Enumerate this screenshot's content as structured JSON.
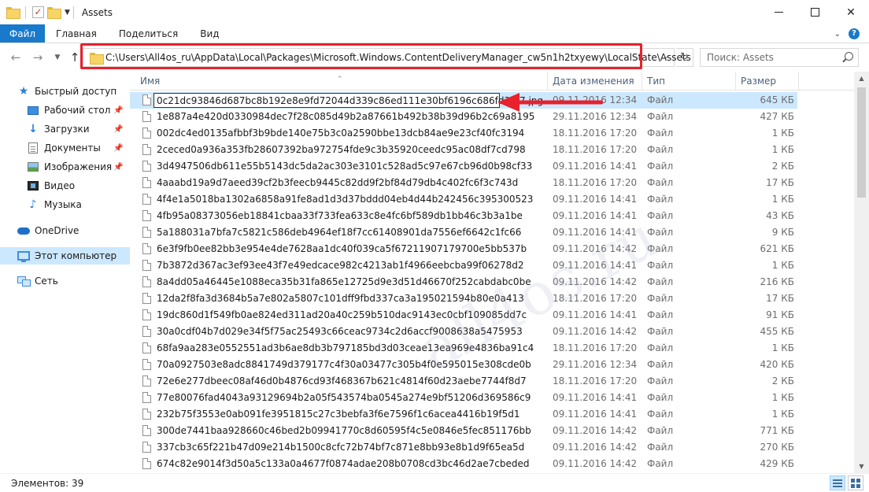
{
  "window": {
    "title": "Assets",
    "minimize_label": "—",
    "close_label": "✕"
  },
  "ribbon": {
    "tabs": [
      "Файл",
      "Главная",
      "Поделиться",
      "Вид"
    ],
    "help_label": "?"
  },
  "address": {
    "path": "C:\\Users\\All4os_ru\\AppData\\Local\\Packages\\Microsoft.Windows.ContentDeliveryManager_cw5n1h2txyewy\\LocalState\\Assets",
    "refresh_label": "↻"
  },
  "search": {
    "placeholder": "Поиск: Assets"
  },
  "nav": {
    "items": [
      {
        "label": "Быстрый доступ",
        "icon": "star-icon"
      },
      {
        "label": "Рабочий стол",
        "icon": "desktop-icon",
        "pinned": true
      },
      {
        "label": "Загрузки",
        "icon": "downloads-icon",
        "pinned": true
      },
      {
        "label": "Документы",
        "icon": "documents-icon",
        "pinned": true
      },
      {
        "label": "Изображения",
        "icon": "pictures-icon",
        "pinned": true
      },
      {
        "label": "Видео",
        "icon": "video-icon"
      },
      {
        "label": "Музыка",
        "icon": "music-icon"
      },
      {
        "label": "OneDrive",
        "icon": "onedrive-icon"
      },
      {
        "label": "Этот компьютер",
        "icon": "this-pc-icon",
        "selected": true
      },
      {
        "label": "Сеть",
        "icon": "network-icon"
      }
    ]
  },
  "columns": {
    "name": "Имя",
    "date": "Дата изменения",
    "type": "Тип",
    "size": "Размер"
  },
  "files": [
    {
      "name": "0c21dc93846d687bc8b192e8e9fd72044d339c86ed111e30bf6196c686fd39f7.jpg",
      "date": "09.11.2016 12:34",
      "type": "Файл",
      "size": "645 КБ",
      "selected": true,
      "renaming": true
    },
    {
      "name": "1e887a4e420d0330984dec7f28c085d49b2a87661b492b38b39d96b2c69a8195",
      "date": "29.11.2016 12:34",
      "type": "Файл",
      "size": "427 КБ"
    },
    {
      "name": "002dc4ed0135afbbf3b9bde140e75b3c0a2590bbe13dcb84ae9e23cf40fc3194",
      "date": "18.11.2016 17:20",
      "type": "Файл",
      "size": "1 КБ"
    },
    {
      "name": "2ceced0a936a353fb28607392ba972754fde9c3b35920ceedc95ac08df7cd798",
      "date": "18.11.2016 17:20",
      "type": "Файл",
      "size": "1 КБ"
    },
    {
      "name": "3d4947506db611e55b5143dc5da2ac303e3101c528ad5c97e67cb96d0b98cf33",
      "date": "09.11.2016 14:41",
      "type": "Файл",
      "size": "2 КБ"
    },
    {
      "name": "4aaabd19a9d7aeed39cf2b3feecb9445c82dd9f2bf84d79db4c402fc6f3c743d",
      "date": "18.11.2016 17:20",
      "type": "Файл",
      "size": "17 КБ"
    },
    {
      "name": "4f4e1a5018ba1302a6858a91fe8ad1d3d37bddd04eb4d44b242456c395300523",
      "date": "09.11.2016 14:41",
      "type": "Файл",
      "size": "1 КБ"
    },
    {
      "name": "4fb95a08373056eb18841cbaa33f733fea633c8e4fc6bf589db1bb46c3b3a1be",
      "date": "09.11.2016 14:41",
      "type": "Файл",
      "size": "43 КБ"
    },
    {
      "name": "5a188031a7bfa7c5821c586deb4964ef18f7cc61408901da7556ef6642c1fc66",
      "date": "09.11.2016 14:41",
      "type": "Файл",
      "size": "9 КБ"
    },
    {
      "name": "6e3f9fb0ee82bb3e954e4de7628aa1dc40f039ca5f67211907179700e5bb537b",
      "date": "09.11.2016 14:42",
      "type": "Файл",
      "size": "621 КБ"
    },
    {
      "name": "7b3872d367ac3ef93ee43f7e49edcace982c4213ab1f4966eebcba99f06278d2",
      "date": "09.11.2016 14:41",
      "type": "Файл",
      "size": "1 КБ"
    },
    {
      "name": "8a4dd05a46445e1088eca35b31fa865e12725d9e3d51d46670f252cabdabc0be",
      "date": "09.11.2016 14:42",
      "type": "Файл",
      "size": "216 КБ"
    },
    {
      "name": "12da2f8fa3d3684b5a7e802a5807c101dff9fbd337ca3a195021594b80e0a413",
      "date": "18.11.2016 17:20",
      "type": "Файл",
      "size": "17 КБ"
    },
    {
      "name": "19dc860d1f549fb0ae824ed311ad20a40c259b510dac9143ec0cbf109085dd7c",
      "date": "09.11.2016 14:41",
      "type": "Файл",
      "size": "91 КБ"
    },
    {
      "name": "30a0cdf04b7d029e34f5f75ac25493c66ceac9734c2d6accf9008638a5475953",
      "date": "09.11.2016 14:42",
      "type": "Файл",
      "size": "455 КБ"
    },
    {
      "name": "68fa9aa283e0552551ad3b6ae8db3b797185bd3d03ceae13ea969e4836ba91c4",
      "date": "18.11.2016 17:20",
      "type": "Файл",
      "size": "1 КБ"
    },
    {
      "name": "70a0927503e8adc8841749d379177c4f30a03477c305b4f0e595015e308cde0b",
      "date": "29.11.2016 12:34",
      "type": "Файл",
      "size": "420 КБ"
    },
    {
      "name": "72e6e277dbeec08af46d0b4876cd93f468367b621c4814f60d23aebe7744f8d7",
      "date": "18.11.2016 17:20",
      "type": "Файл",
      "size": "2 КБ"
    },
    {
      "name": "77e80076fad4043a93129694b2a05f543574ba0545a274e9bf51206d369586c9",
      "date": "09.11.2016 14:41",
      "type": "Файл",
      "size": "1 КБ"
    },
    {
      "name": "232b75f3553e0ab091fe3951815c27c3bebfa3f6e7596f1c6acea4416b19f5d1",
      "date": "09.11.2016 14:41",
      "type": "Файл",
      "size": "1 КБ"
    },
    {
      "name": "300de7441baa928660c46bed2b09941770c8d60595f4c5e0846e5fec851176bb",
      "date": "09.11.2016 14:42",
      "type": "Файл",
      "size": "771 КБ"
    },
    {
      "name": "337cb3c65f221b47d09e214b1500c8cfc72b74bf7c871e8bb93e8b1d9f65ea5d",
      "date": "09.11.2016 14:42",
      "type": "Файл",
      "size": "270 КБ"
    },
    {
      "name": "674c82e9014f3d50a5c133a0a4677f0874adae208b0708cd3bc46d2ae7cbeded",
      "date": "09.11.2016 14:42",
      "type": "Файл",
      "size": "429 КБ"
    }
  ],
  "watermark": "all4os.ru",
  "status": {
    "count_text": "Элементов: 39"
  },
  "colors": {
    "accent": "#1979ca",
    "selection": "#cce8ff",
    "highlight_red": "#e8212d"
  }
}
